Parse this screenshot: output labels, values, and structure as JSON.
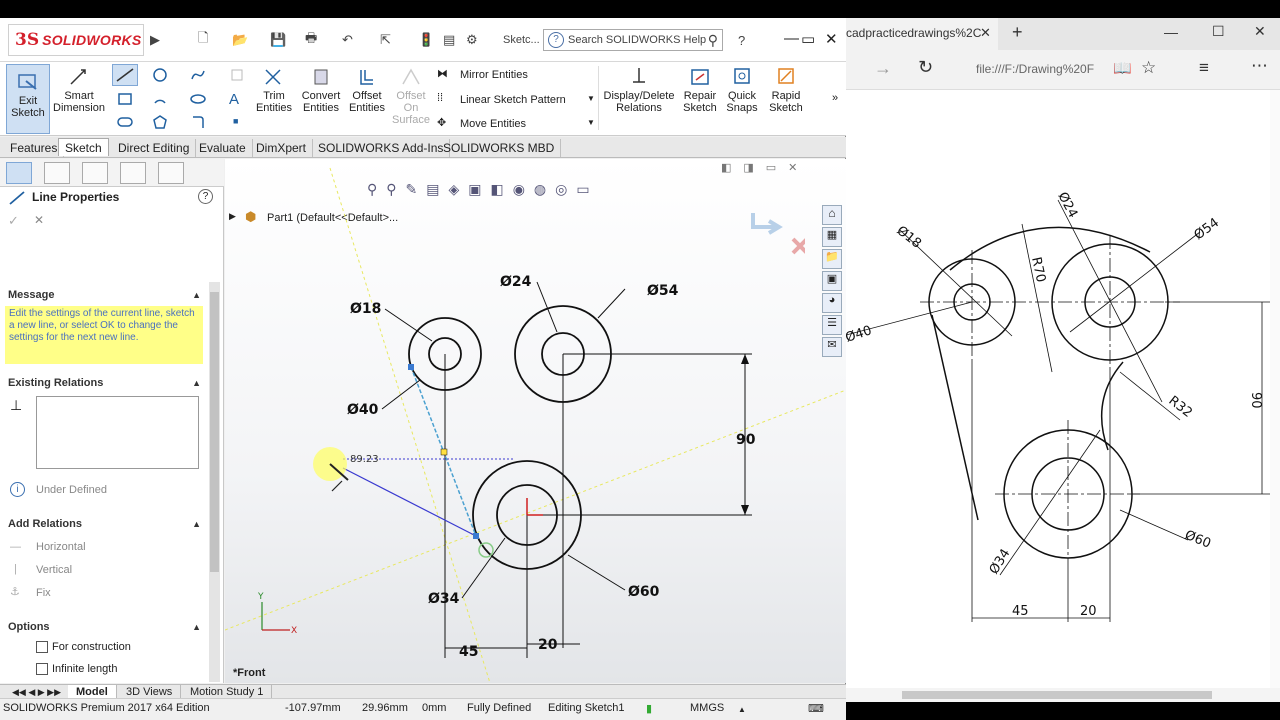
{
  "solidworks": {
    "logo_text": "SOLIDWORKS",
    "sketch_label": "Sketc...",
    "search_placeholder": "Search SOLIDWORKS Help",
    "ribbon": {
      "exit_sketch": "Exit Sketch",
      "smart_dimension": "Smart Dimension",
      "trim_entities": "Trim Entities",
      "convert_entities": "Convert Entities",
      "offset_entities": "Offset Entities",
      "offset_on_surface": "Offset On Surface",
      "mirror_entities": "Mirror Entities",
      "linear_sketch_pattern": "Linear Sketch Pattern",
      "move_entities": "Move Entities",
      "display_delete_relations": "Display/Delete Relations",
      "repair_sketch": "Repair Sketch",
      "quick_snaps": "Quick Snaps",
      "rapid_sketch": "Rapid Sketch"
    },
    "command_tabs": [
      "Features",
      "Sketch",
      "Direct Editing",
      "Evaluate",
      "DimXpert",
      "SOLIDWORKS Add-Ins",
      "SOLIDWORKS MBD"
    ],
    "active_tab": "Sketch",
    "property_manager": {
      "title": "Line Properties",
      "message_header": "Message",
      "message_text": "Edit the settings of the current line, sketch a new line, or select OK to change the settings for the next new line.",
      "existing_relations_header": "Existing Relations",
      "status": "Under Defined",
      "add_relations_header": "Add Relations",
      "relations": [
        "Horizontal",
        "Vertical",
        "Fix"
      ],
      "options_header": "Options",
      "options": [
        "For construction",
        "Infinite length"
      ]
    },
    "tree_item": "Part1  (Default<<Default>...",
    "view_label": "*Front",
    "sketch_dimensions": {
      "d18": "Ø18",
      "d24": "Ø24",
      "d54": "Ø54",
      "d40": "Ø40",
      "d34": "Ø34",
      "d60": "Ø60",
      "v90": "90",
      "h45": "45",
      "h20": "20",
      "angle": "89.23"
    },
    "bottom_tabs": [
      "Model",
      "3D Views",
      "Motion Study 1"
    ],
    "statusbar": {
      "edition": "SOLIDWORKS Premium 2017 x64 Edition",
      "x": "-107.97mm",
      "y": "29.96mm",
      "z": "0mm",
      "defined": "Fully Defined",
      "editing": "Editing Sketch1",
      "units": "MMGS"
    }
  },
  "browser": {
    "tab_title": "cadpracticedrawings%2C",
    "address": "file:///F:/Drawing%20F",
    "drawing_labels": {
      "d24": "Ø24",
      "d18": "Ø18",
      "d54": "Ø54",
      "r70": "R70",
      "d40": "Ø40",
      "v90": "90",
      "r32": "R32",
      "d60": "Ø60",
      "d34": "Ø34",
      "h45": "45",
      "h20": "20"
    }
  },
  "colors": {
    "sketch_black": "#111111",
    "sketch_blue": "#3a3ad0",
    "construction_yellow": "#e8e860",
    "pm_message_bg": "#ffff88",
    "brand_red": "#d4202b"
  }
}
